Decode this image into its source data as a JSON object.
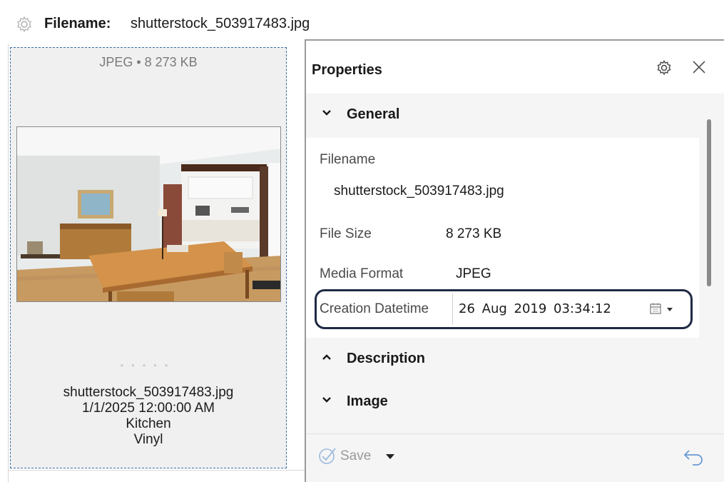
{
  "topbar": {
    "filename_label": "Filename:",
    "filename_value": "shutterstock_503917483.jpg",
    "icon": "gear-icon"
  },
  "gallery": {
    "card": {
      "meta": "JPEG • 8 273 KB",
      "dots": "▫▫▫▫▫",
      "caption": {
        "filename": "shutterstock_503917483.jpg",
        "date": "1/1/2025 12:00:00 AM",
        "room": "Kitchen",
        "material": "Vinyl"
      }
    }
  },
  "panel": {
    "title": "Properties",
    "sections": {
      "general": {
        "title": "General",
        "expanded": true
      },
      "description": {
        "title": "Description",
        "expanded": false
      },
      "image": {
        "title": "Image",
        "expanded": true
      }
    },
    "fields": {
      "filename_label": "Filename",
      "filename_value": "shutterstock_503917483.jpg",
      "filesize_label": "File Size",
      "filesize_value": "8 273 KB",
      "mediaformat_label": "Media Format",
      "mediaformat_value": "JPEG",
      "creation_label": "Creation Datetime",
      "creation_value": "26  Aug  2019   03:34:12"
    },
    "footer": {
      "save_label": "Save"
    }
  },
  "colors": {
    "accent_focus": "#1f2a44",
    "card_border": "#3a6ea5",
    "save_icon": "#9db9e0",
    "undo_icon": "#6a9ad2"
  }
}
